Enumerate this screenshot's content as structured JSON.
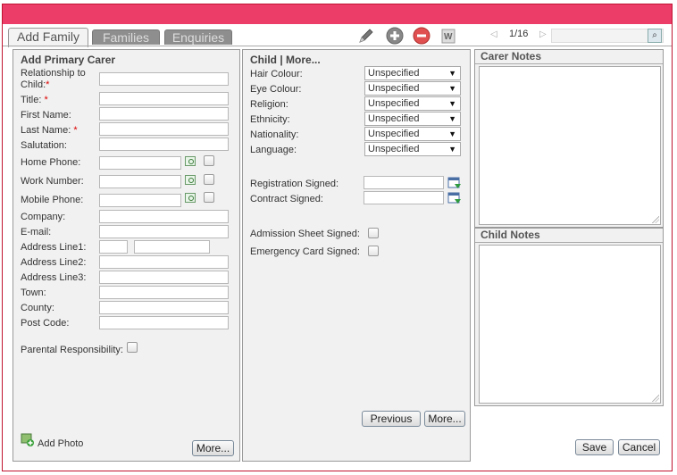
{
  "tabs": [
    {
      "label": "Add Family"
    },
    {
      "label": "Families"
    },
    {
      "label": "Enquiries"
    }
  ],
  "toolbar": {
    "edit_icon": "pencil-icon",
    "add_icon": "plus-circle-icon",
    "remove_icon": "minus-circle-icon",
    "doc_icon": "word-document-icon",
    "pager_text": "1/16",
    "search_value": ""
  },
  "carer": {
    "title": "Add Primary Carer",
    "fields": {
      "relationship_l1": "Relationship to",
      "relationship_l2": "Child:",
      "title": "Title:",
      "first_name": "First Name:",
      "last_name": "Last Name:",
      "salutation": "Salutation:",
      "home_phone": "Home Phone:",
      "work_number": "Work Number:",
      "mobile_phone": "Mobile Phone:",
      "company": "Company:",
      "email": "E-mail:",
      "address1": "Address Line1:",
      "address2": "Address Line2:",
      "address3": "Address Line3:",
      "town": "Town:",
      "county": "County:",
      "post_code": "Post Code:",
      "parental": "Parental Responsibility:"
    },
    "required_mark": "*",
    "add_photo": "Add Photo",
    "more_button": "More..."
  },
  "child": {
    "title": "Child | More...",
    "selects": [
      {
        "label": "Hair Colour:",
        "value": "Unspecified"
      },
      {
        "label": "Eye Colour:",
        "value": "Unspecified"
      },
      {
        "label": "Religion:",
        "value": "Unspecified"
      },
      {
        "label": "Ethnicity:",
        "value": "Unspecified"
      },
      {
        "label": "Nationality:",
        "value": "Unspecified"
      },
      {
        "label": "Language:",
        "value": "Unspecified"
      }
    ],
    "registration_signed": "Registration Signed:",
    "contract_signed": "Contract Signed:",
    "admission_sheet": "Admission Sheet Signed:",
    "emergency_card": "Emergency Card Signed:",
    "previous_button": "Previous",
    "more_button": "More..."
  },
  "notes": {
    "carer_notes": "Carer Notes",
    "child_notes": "Child Notes"
  },
  "actions": {
    "save": "Save",
    "cancel": "Cancel"
  },
  "colors": {
    "header_bar": "#ec3d68",
    "frame_border": "#c0142f"
  }
}
